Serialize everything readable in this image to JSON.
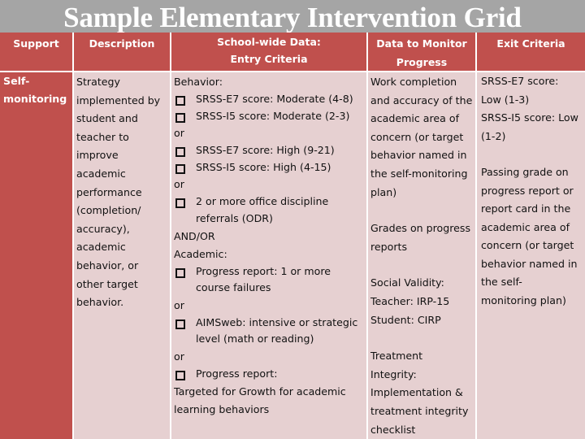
{
  "title": "Sample Elementary Intervention Grid",
  "colors": {
    "header_bg": "#c0504d",
    "body_bg": "#e6d0d1",
    "title_bg": "#a5a5a5"
  },
  "headers": {
    "support": "Support",
    "description": "Description",
    "entry_line1": "School-wide Data:",
    "entry_line2": "Entry Criteria",
    "monitor_line1": "Data to Monitor",
    "monitor_line2": "Progress",
    "exit": "Exit Criteria"
  },
  "row": {
    "support": [
      "Self-",
      "monitoring"
    ],
    "description": [
      "Strategy",
      "implemented by",
      "student and",
      "teacher to",
      "improve",
      "academic",
      "performance",
      "(completion/",
      "accuracy),",
      "academic",
      "behavior, or",
      "other target",
      "behavior."
    ],
    "entry": {
      "behavior_label": "Behavior:",
      "cb1": "SRSS-E7 score: Moderate (4-8)",
      "cb2": "SRSS-I5 score: Moderate (2-3)",
      "or1": "or",
      "cb3": "SRSS-E7 score: High (9-21)",
      "cb4": "SRSS-I5 score: High (4-15)",
      "or2": "or",
      "cb5_line1": "2 or more office discipline",
      "cb5_line2": "referrals (ODR)",
      "andor": "AND/OR",
      "academic_label": "Academic:",
      "cb6_line1": "Progress report: 1 or more",
      "cb6_line2": "course failures",
      "or3": "or",
      "cb7_line1": "AIMSweb: intensive or strategic",
      "cb7_line2": "level (math or reading)",
      "or4": "or",
      "cb8": "Progress report:",
      "tail_line1": "Targeted for Growth for academic",
      "tail_line2": "learning behaviors"
    },
    "monitor": {
      "block1": [
        "Work completion",
        "and accuracy of the",
        "academic area of",
        "concern (or target",
        "behavior named in",
        "the self-monitoring",
        "plan)"
      ],
      "block2": [
        "Grades on progress",
        "reports"
      ],
      "block3": [
        "Social Validity:",
        "Teacher: IRP-15",
        "Student: CIRP"
      ],
      "block4": [
        "Treatment",
        "Integrity:",
        "Implementation &",
        "treatment integrity",
        "checklist"
      ]
    },
    "exit": {
      "block1": [
        "SRSS-E7 score:",
        "Low (1-3)",
        "SRSS-I5 score: Low",
        "(1-2)"
      ],
      "block2": [
        "Passing grade on",
        "progress report or",
        "report card in the",
        "academic area of",
        "concern (or target",
        "behavior named in",
        "the self-",
        "monitoring plan)"
      ]
    }
  }
}
